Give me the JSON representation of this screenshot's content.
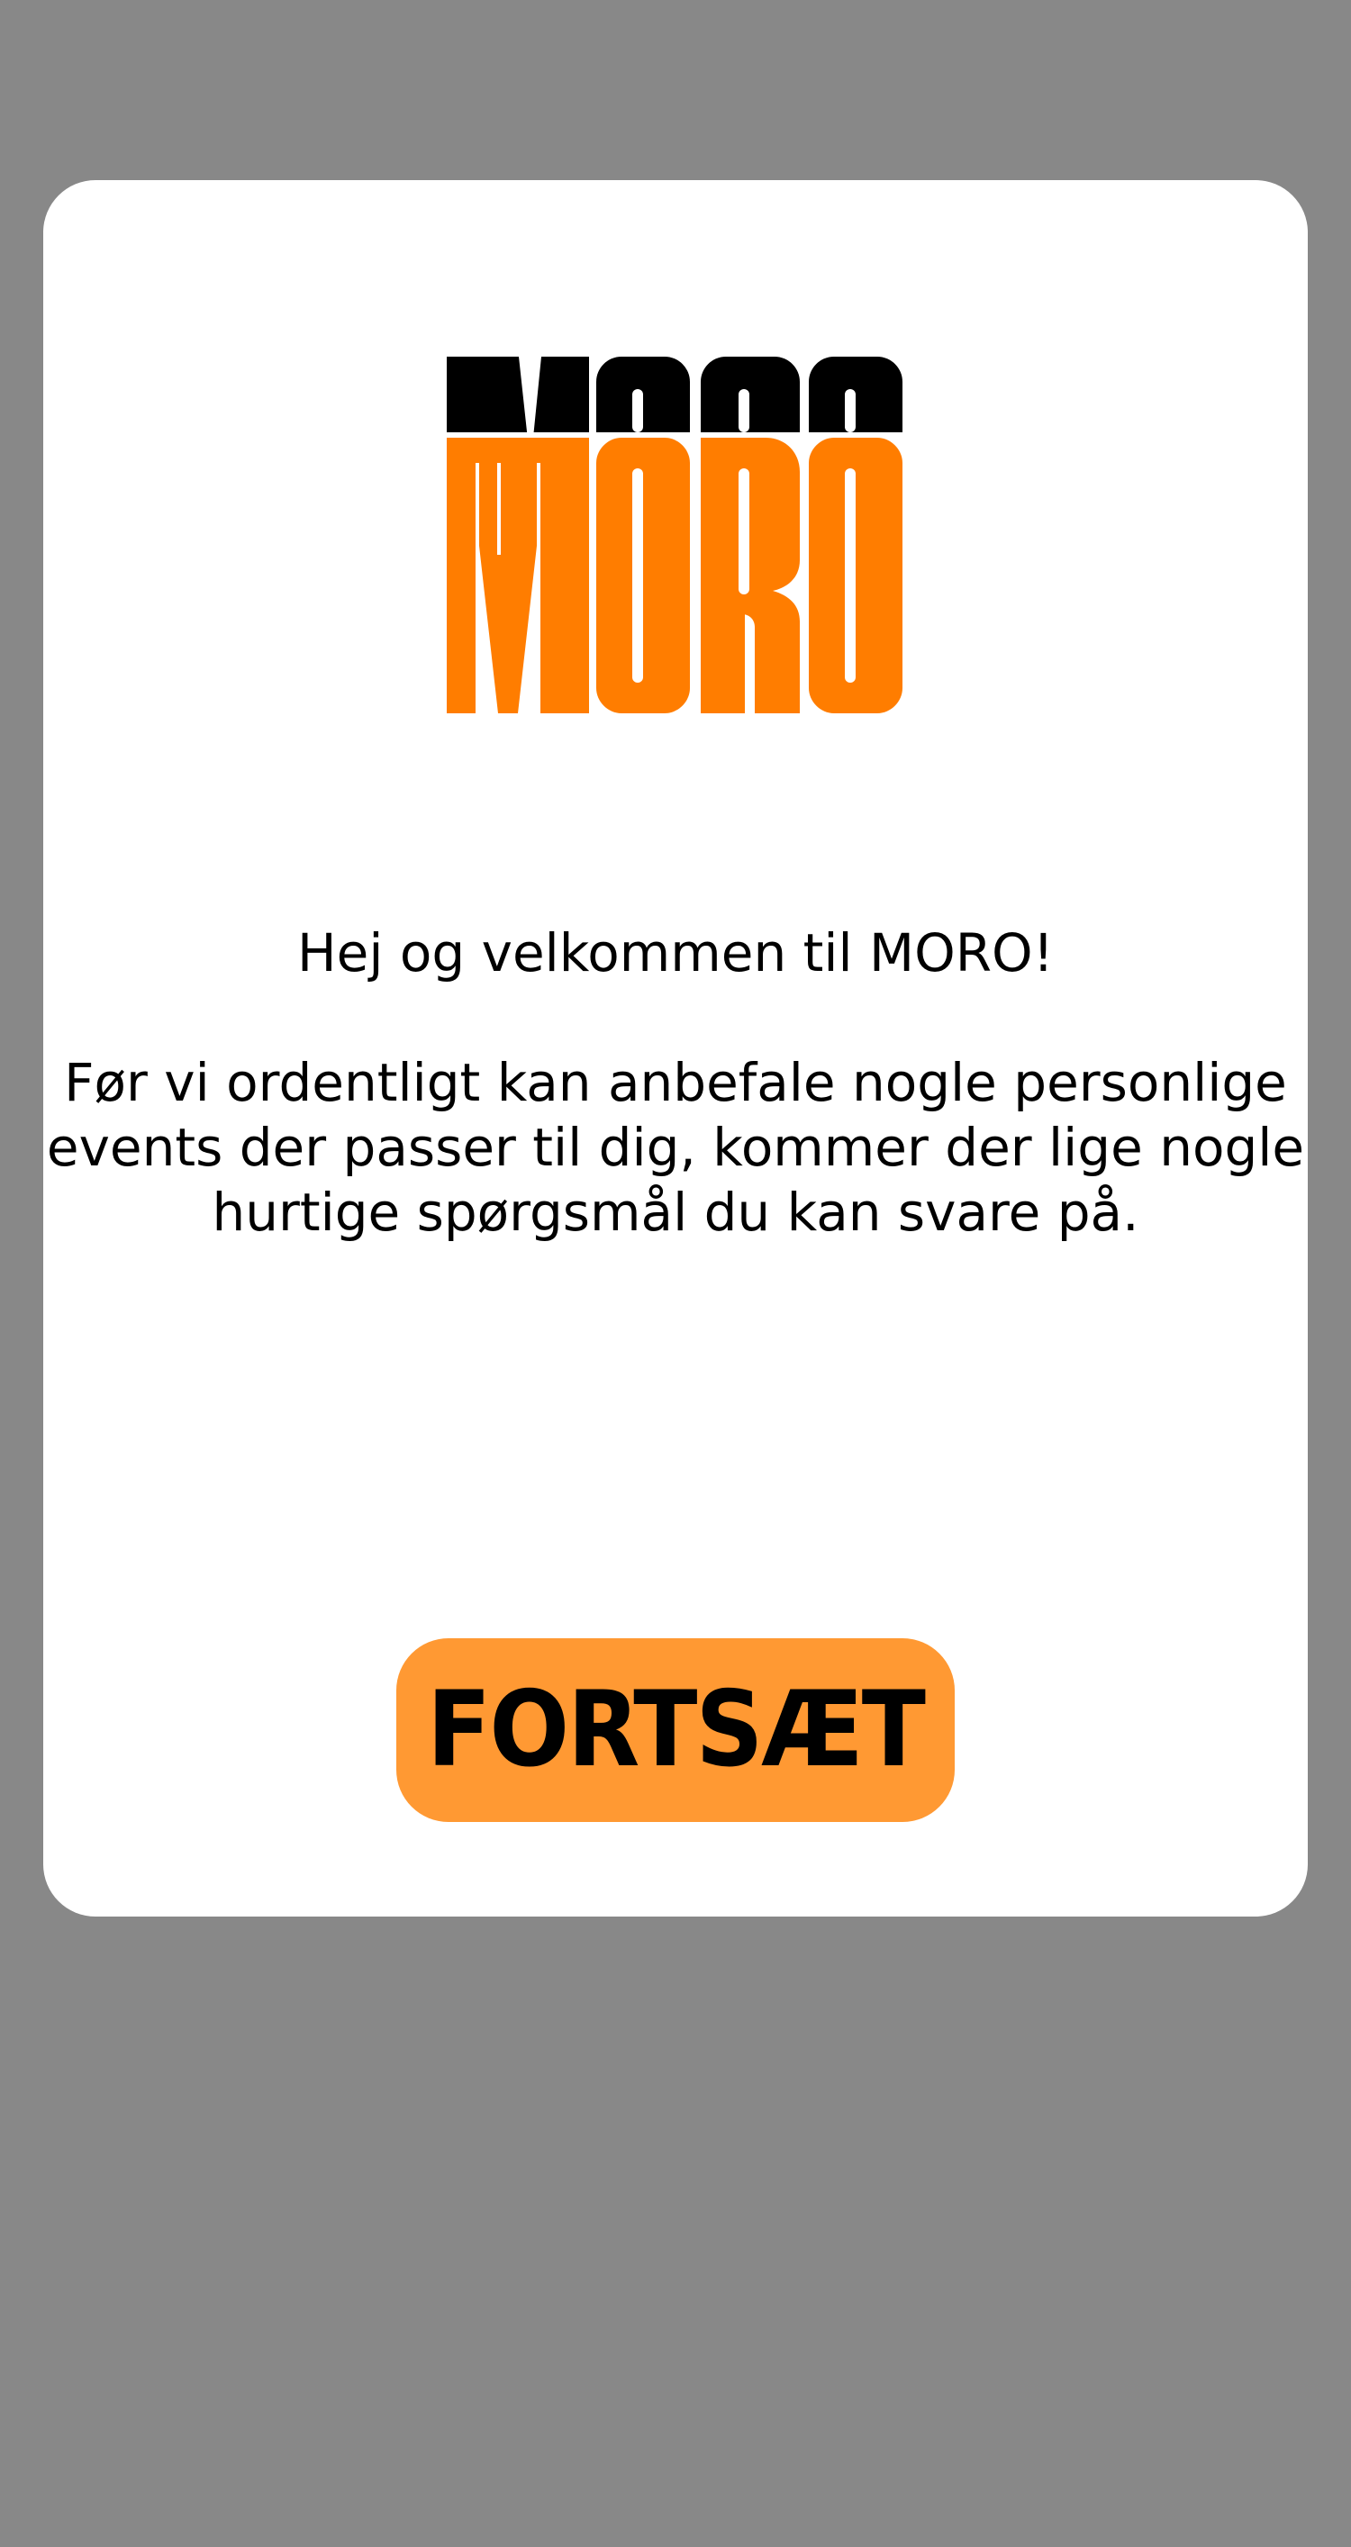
{
  "screen": {
    "background_color": "#888888"
  },
  "card": {
    "background_color": "#ffffff"
  },
  "logo": {
    "text": "MORO",
    "primary_color": "#ff7d00",
    "shadow_color": "#000000"
  },
  "content": {
    "welcome": "Hej og velkommen til MORO!",
    "intro": "Før vi ordentligt kan anbefale nogle personlige events der passer til dig, kommer der lige nogle hurtige spørgsmål du kan svare på."
  },
  "continue_button": {
    "label": "FORTSÆT",
    "background_color": "#ff9933",
    "text_color": "#000000"
  }
}
